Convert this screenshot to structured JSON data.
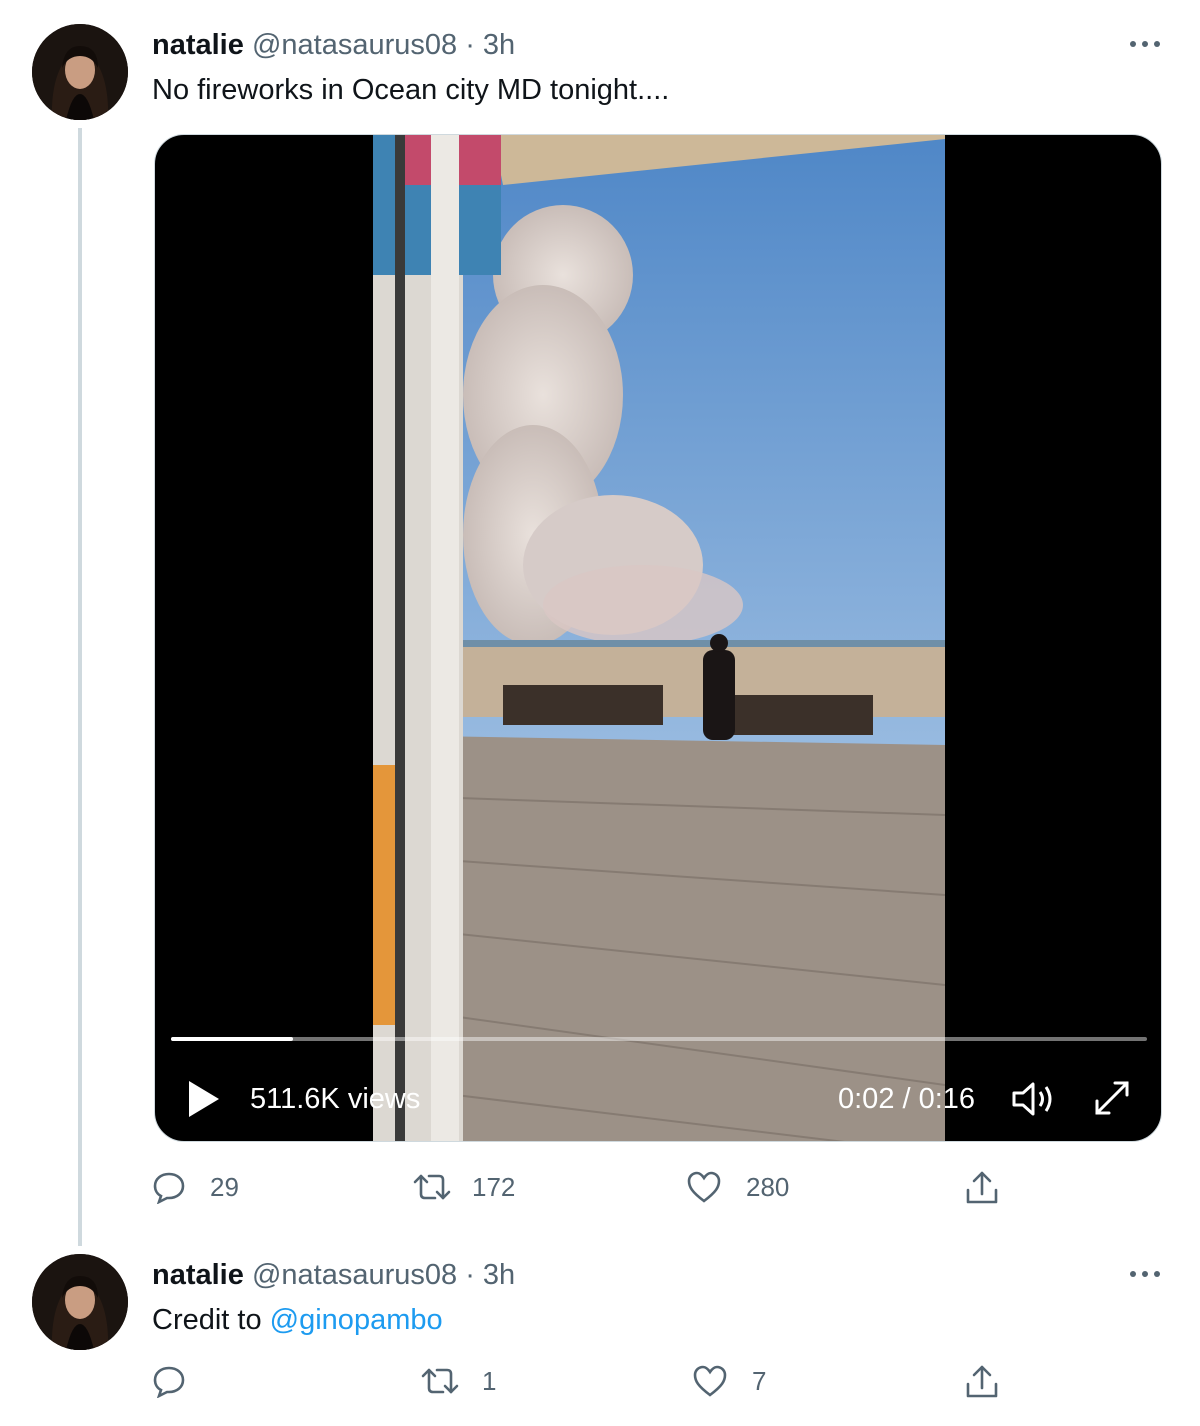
{
  "tweets": [
    {
      "name": "natalie",
      "handle": "@natasaurus08",
      "separator": "·",
      "time": "3h",
      "more_icon": "more-horizontal-icon",
      "text": "No fireworks in Ocean city MD tonight....",
      "video": {
        "views": "511.6K views",
        "time_display": "0:02 / 0:16",
        "progress": 0.125,
        "icons": [
          "play-icon",
          "volume-icon",
          "fullscreen-icon"
        ]
      },
      "actions": {
        "replies": "29",
        "retweets": "172",
        "likes": "280"
      }
    },
    {
      "name": "natalie",
      "handle": "@natasaurus08",
      "separator": "·",
      "time": "3h",
      "more_icon": "more-horizontal-icon",
      "text_prefix": "Credit to ",
      "mention": "@ginopambo",
      "actions": {
        "replies": "",
        "retweets": "1",
        "likes": "7"
      }
    }
  ],
  "colors": {
    "link": "#1d9bf0",
    "secondary_text": "#536471",
    "thread_line": "#cfd9de"
  }
}
